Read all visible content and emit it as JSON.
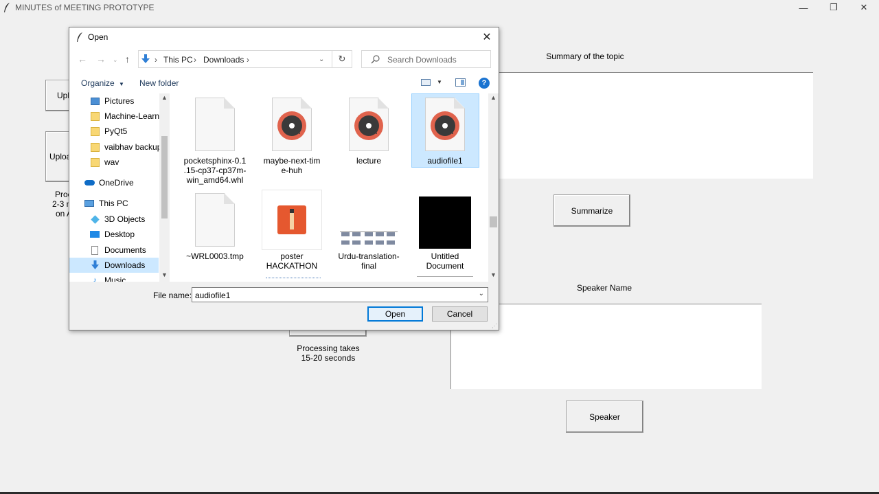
{
  "app": {
    "title": "MINUTES of MEETING PROTOTYPE",
    "left_buttons": [
      "Upl",
      "Uploa"
    ],
    "left_note": [
      "Proc",
      "2-3 m",
      "on A"
    ],
    "summary_label": "Summary of the topic",
    "summarize_button": "Summarize",
    "processing_note": [
      "Processing takes",
      "15-20 seconds"
    ],
    "speaker_name_label": "Speaker Name",
    "speaker_button": "Speaker"
  },
  "window_controls": {
    "minimize": "—",
    "restore": "❐",
    "close": "✕"
  },
  "dialog": {
    "title": "Open",
    "close_glyph": "✕",
    "address": {
      "root": "This PC",
      "folder": "Downloads"
    },
    "search_placeholder": "Search Downloads",
    "toolbar": {
      "organize": "Organize",
      "new_folder": "New folder",
      "help": "?"
    },
    "nav_items": [
      {
        "label": "Pictures",
        "icon": "pictures-icon"
      },
      {
        "label": "Machine-Learnin",
        "icon": "folder-icon"
      },
      {
        "label": "PyQt5",
        "icon": "folder-icon"
      },
      {
        "label": "vaibhav backup",
        "icon": "folder-icon"
      },
      {
        "label": "wav",
        "icon": "folder-icon"
      },
      {
        "label": "OneDrive",
        "icon": "onedrive-icon"
      },
      {
        "label": "This PC",
        "icon": "computer-icon"
      },
      {
        "label": "3D Objects",
        "icon": "cube-icon"
      },
      {
        "label": "Desktop",
        "icon": "desktop-icon"
      },
      {
        "label": "Documents",
        "icon": "documents-icon"
      },
      {
        "label": "Downloads",
        "icon": "download-icon"
      },
      {
        "label": "Music",
        "icon": "music-icon"
      }
    ],
    "files": [
      {
        "name": "pocketsphinx-0.1\n.15-cp37-cp37m-\nwin_amd64.whl",
        "icon": "generic-file-icon"
      },
      {
        "name": "maybe-next-tim\ne-huh",
        "icon": "audio-file-icon"
      },
      {
        "name": "lecture",
        "icon": "audio-file-icon"
      },
      {
        "name": "audiofile1",
        "icon": "audio-file-icon"
      },
      {
        "name": "~WRL0003.tmp",
        "icon": "generic-file-icon"
      },
      {
        "name": "poster\nHACKATHON",
        "icon": "sketchbook-image-icon"
      },
      {
        "name": "Urdu-translation-\nfinal",
        "icon": "diagram-image-icon"
      },
      {
        "name": "Untitled\nDocument",
        "icon": "black-image-icon"
      }
    ],
    "selected_file": "audiofile1",
    "file_name_label": "File name:",
    "file_name_value": "audiofile1",
    "open_button": "Open",
    "cancel_button": "Cancel"
  },
  "colors": {
    "accent": "#0078d7",
    "selection": "#cce8ff",
    "folder": "#f8d774"
  }
}
